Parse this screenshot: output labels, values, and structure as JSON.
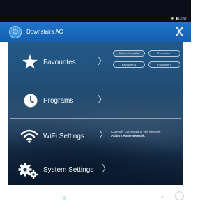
{
  "status_bar": {
    "icons": "✱ ▮",
    "time": "10:47"
  },
  "header": {
    "device_name": "Downstairs AC",
    "power_icon": "⏻",
    "close_label": "X"
  },
  "menu": {
    "favourites": {
      "label": "Favourites",
      "icon": "star-icon",
      "pills": [
        "Active Favourite",
        "Favourite 2",
        "Favourite 3",
        "Favourite 4"
      ],
      "selected_pill": "Active Favourite"
    },
    "programs": {
      "label": "Programs",
      "icon": "clock-icon"
    },
    "wifi": {
      "label": "WiFi Settings",
      "icon": "wifi-icon",
      "status_line": "Currently Connected to Wifi Network:",
      "network_name": "Adam's Home Network."
    },
    "system": {
      "label": "System Settings",
      "icon": "gears-icon"
    },
    "chevron": "〉"
  },
  "colors": {
    "header": "#1a6bbf",
    "accent_light": "#3f97e4",
    "nav_home": "#c5ebe9"
  }
}
